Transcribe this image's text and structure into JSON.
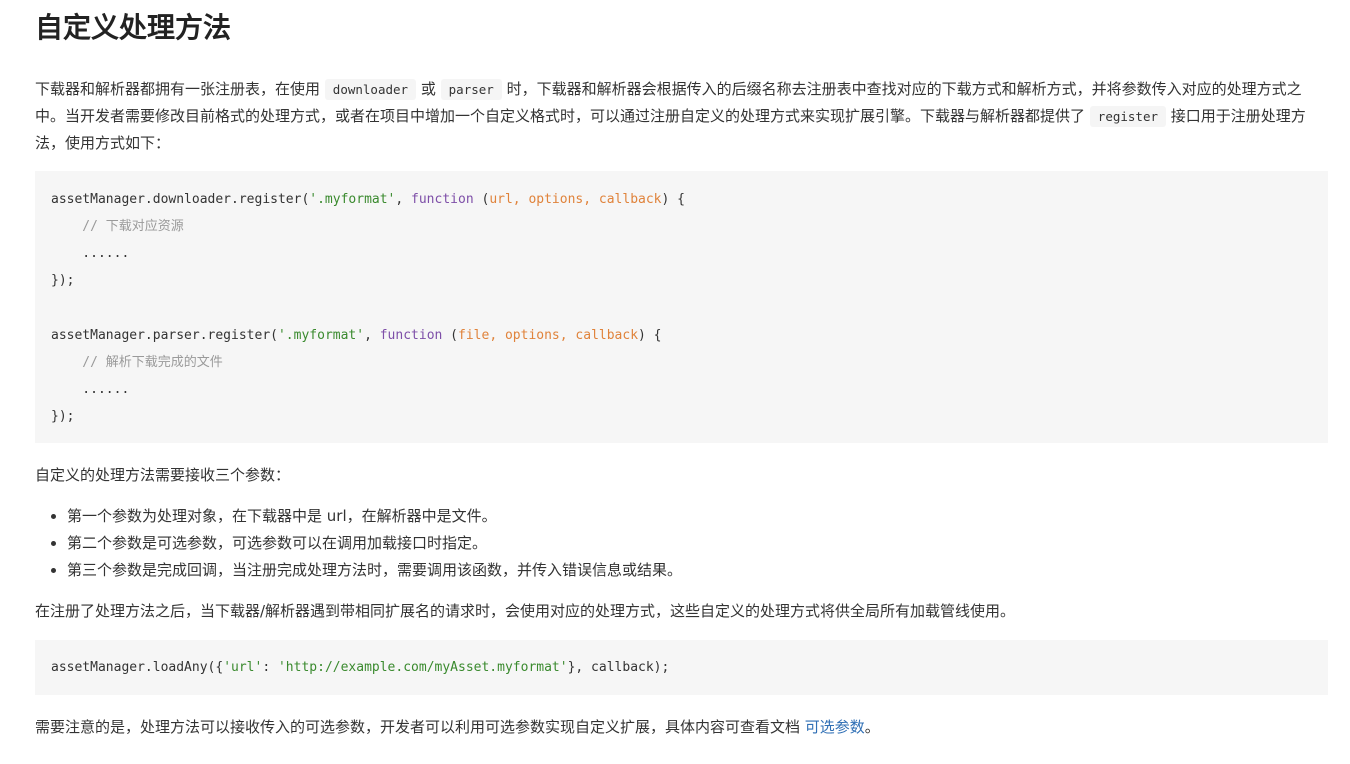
{
  "title": "自定义处理方法",
  "p1": {
    "t1": "下载器和解析器都拥有一张注册表，在使用",
    "code1": "downloader",
    "t2": "或",
    "code2": "parser",
    "t3": "时，下载器和解析器会根据传入的后缀名称去注册表中查找对应的下载方式和解析方式，并将参数传入对应的处理方式之中。当开发者需要修改目前格式的处理方式，或者在项目中增加一个自定义格式时，可以通过注册自定义的处理方式来实现扩展引擎。下载器与解析器都提供了",
    "code3": "register",
    "t4": "接口用于注册处理方法，使用方式如下："
  },
  "code_block_1": {
    "l1_a": "assetManager.downloader.register(",
    "l1_str": "'.myformat'",
    "l1_b": ", ",
    "l1_kw": "function",
    "l1_c": " (",
    "l1_params": "url, options, callback",
    "l1_d": ") {",
    "l2": "    // 下载对应资源",
    "l3": "    ......",
    "l4": "});",
    "l6_a": "assetManager.parser.register(",
    "l6_str": "'.myformat'",
    "l6_b": ", ",
    "l6_kw": "function",
    "l6_c": " (",
    "l6_params": "file, options, callback",
    "l6_d": ") {",
    "l7": "    // 解析下载完成的文件",
    "l8": "    ......",
    "l9": "});"
  },
  "p2": "自定义的处理方法需要接收三个参数：",
  "bullets": [
    "第一个参数为处理对象，在下载器中是 url，在解析器中是文件。",
    "第二个参数是可选参数，可选参数可以在调用加载接口时指定。",
    "第三个参数是完成回调，当注册完成处理方法时，需要调用该函数，并传入错误信息或结果。"
  ],
  "p3": "在注册了处理方法之后，当下载器/解析器遇到带相同扩展名的请求时，会使用对应的处理方式，这些自定义的处理方式将供全局所有加载管线使用。",
  "code_block_2": {
    "a": "assetManager.loadAny({",
    "key": "'url'",
    "b": ": ",
    "val": "'http://example.com/myAsset.myformat'",
    "c": "}, callback);"
  },
  "p4": {
    "text": "需要注意的是，处理方法可以接收传入的可选参数，开发者可以利用可选参数实现自定义扩展，具体内容可查看文档 ",
    "link": "可选参数",
    "end": "。"
  }
}
